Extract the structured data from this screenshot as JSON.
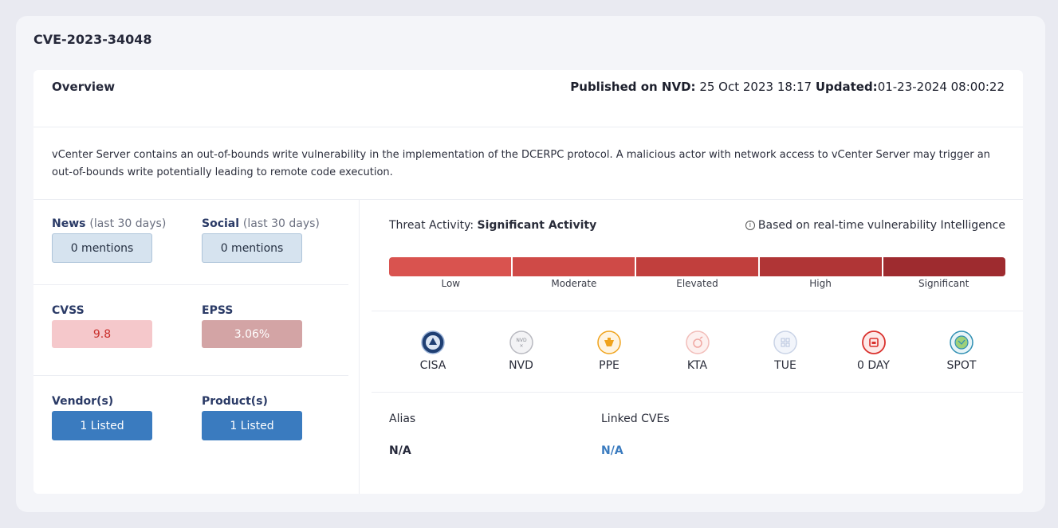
{
  "cve_id": "CVE-2023-34048",
  "overview": {
    "title": "Overview",
    "published_label": "Published on NVD:",
    "published_value": "25 Oct 2023 18:17",
    "updated_label": "Updated:",
    "updated_value": "01-23-2024 08:00:22"
  },
  "description": "vCenter Server contains an out-of-bounds write vulnerability in the implementation of the DCERPC protocol. A malicious actor with network access to vCenter Server may trigger an out-of-bounds write potentially leading to remote code execution.",
  "metrics": {
    "news": {
      "label": "News",
      "sub": "(last 30 days)",
      "value": "0 mentions"
    },
    "social": {
      "label": "Social",
      "sub": "(last 30 days)",
      "value": "0 mentions"
    },
    "cvss": {
      "label": "CVSS",
      "value": "9.8"
    },
    "epss": {
      "label": "EPSS",
      "value": "3.06%"
    },
    "vendors": {
      "label": "Vendor(s)",
      "value": "1 Listed"
    },
    "products": {
      "label": "Product(s)",
      "value": "1 Listed"
    }
  },
  "threat": {
    "label": "Threat Activity:",
    "level": "Significant Activity",
    "info": "Based on real-time vulnerability Intelligence",
    "info_icon": "info-icon",
    "scale": [
      {
        "label": "Low",
        "color": "#d9534f"
      },
      {
        "label": "Moderate",
        "color": "#cf4a47"
      },
      {
        "label": "Elevated",
        "color": "#c13f3d"
      },
      {
        "label": "High",
        "color": "#b03536"
      },
      {
        "label": "Significant",
        "color": "#9e2b2f"
      }
    ]
  },
  "sources": [
    {
      "label": "CISA",
      "icon": "cisa-seal-icon"
    },
    {
      "label": "NVD",
      "icon": "nvd-icon"
    },
    {
      "label": "PPE",
      "icon": "ppe-icon"
    },
    {
      "label": "KTA",
      "icon": "kta-icon"
    },
    {
      "label": "TUE",
      "icon": "tue-icon"
    },
    {
      "label": "0 DAY",
      "icon": "zero-day-icon"
    },
    {
      "label": "SPOT",
      "icon": "spot-icon"
    }
  ],
  "alias": {
    "label": "Alias",
    "value": "N/A"
  },
  "linked_cves": {
    "label": "Linked CVEs",
    "value": "N/A"
  }
}
